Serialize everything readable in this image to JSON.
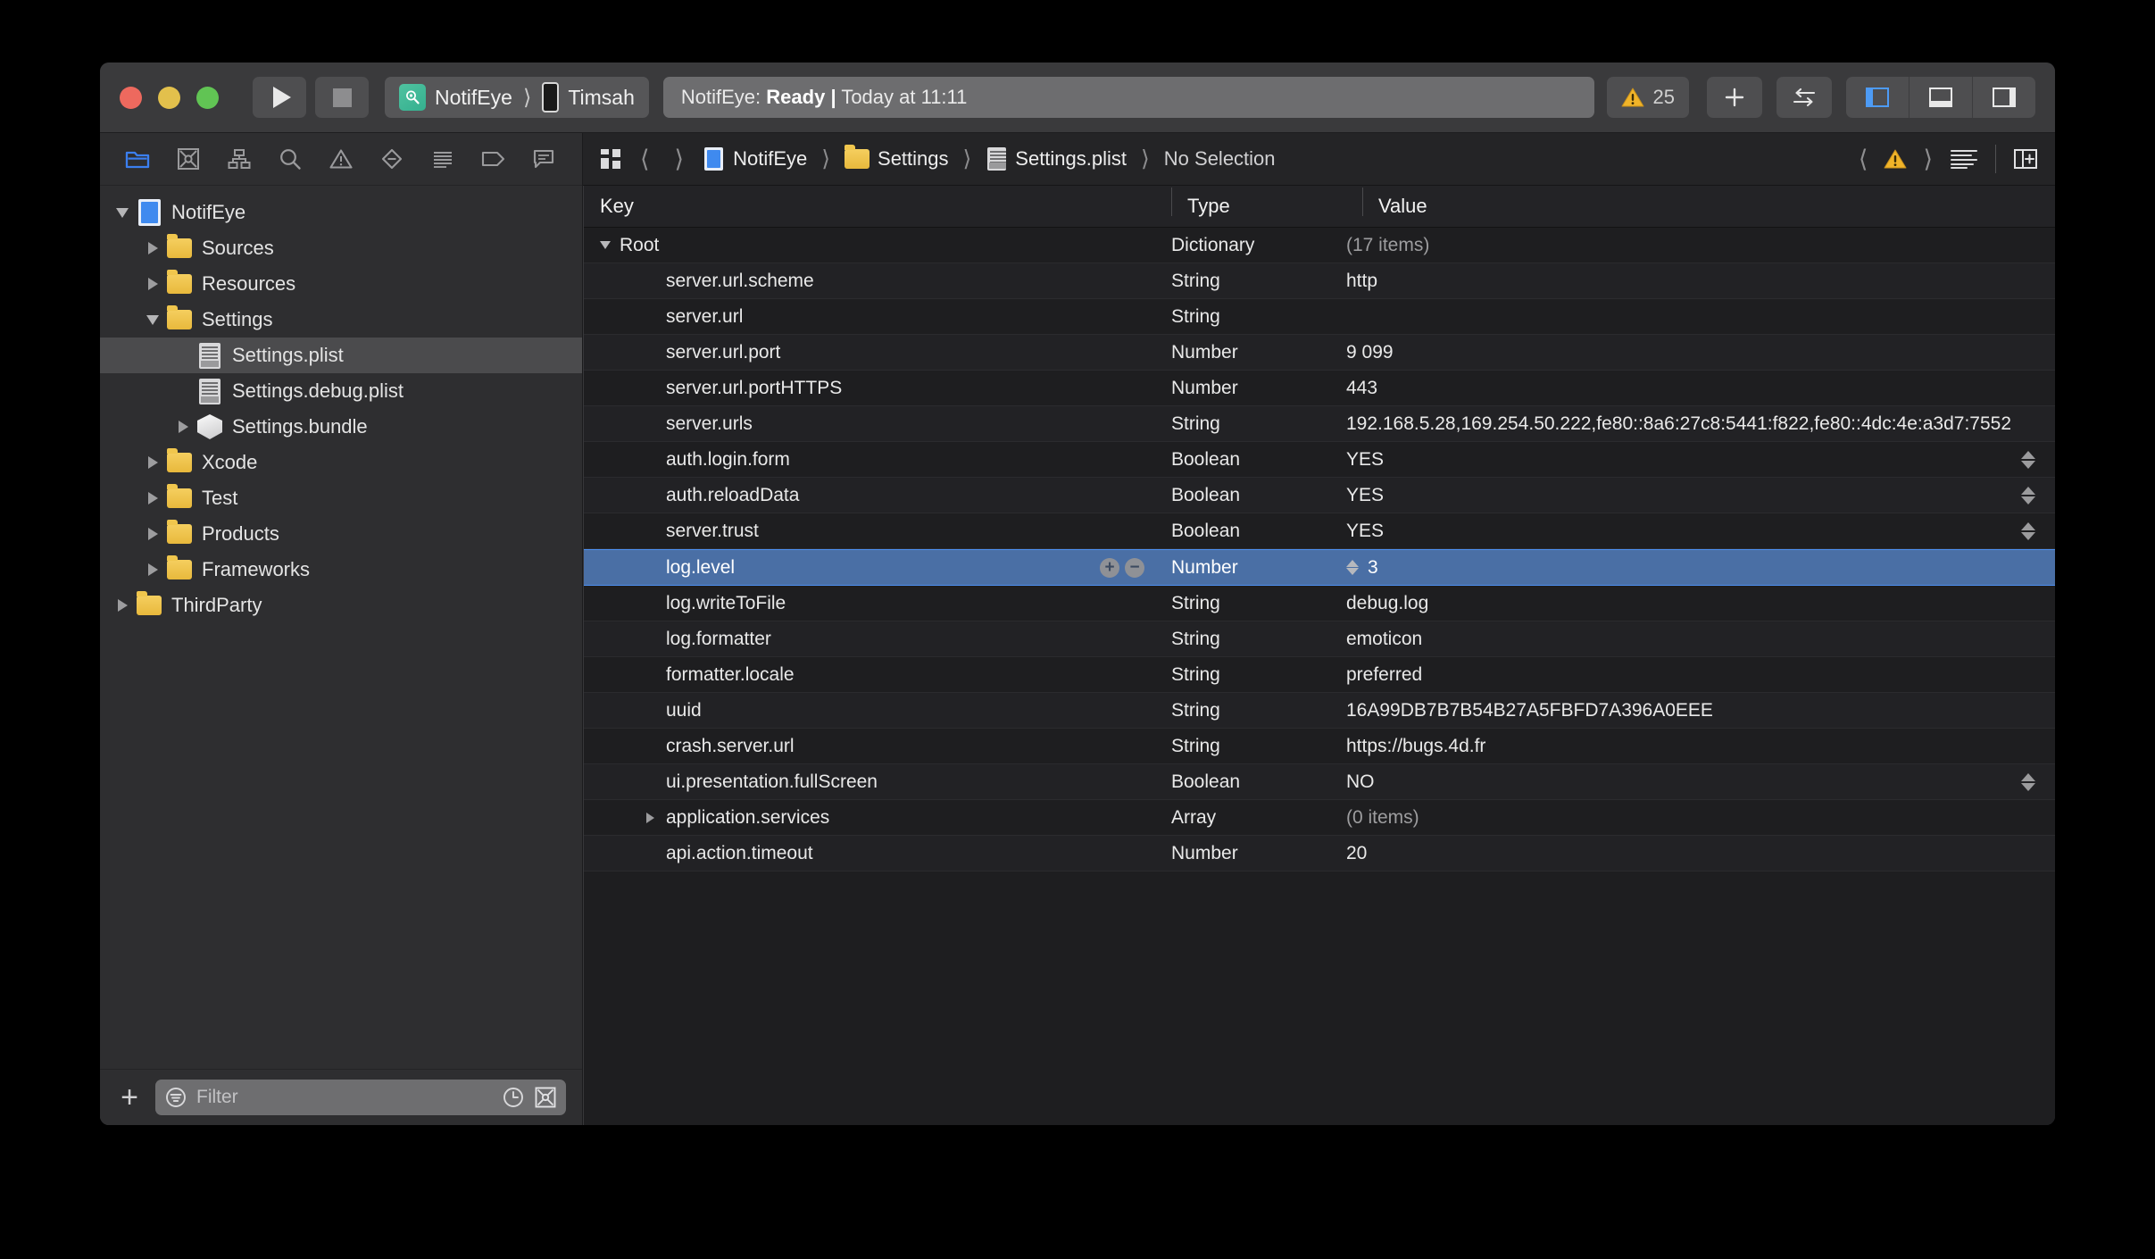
{
  "titlebar": {
    "scheme": {
      "project": "NotifEye",
      "destination": "Timsah",
      "icon": "app-scheme-icon",
      "device_icon": "iphone-icon"
    },
    "run_icon": "play-icon",
    "stop_icon": "stop-icon",
    "status": {
      "prefix": "NotifEye:",
      "state": "Ready",
      "separator": "|",
      "time": "Today at 11:11"
    },
    "warnings": {
      "icon": "warning-triangle-icon",
      "count": "25"
    },
    "buttons": {
      "add": "+",
      "add_icon": "plus-icon",
      "swap_icon": "swap-arrows-icon"
    },
    "panels": [
      {
        "name": "toggle-navigator",
        "icon": "left-panel-icon",
        "active": true
      },
      {
        "name": "toggle-debug-area",
        "icon": "bottom-panel-icon",
        "active": false
      },
      {
        "name": "toggle-inspector",
        "icon": "right-panel-icon",
        "active": false
      }
    ]
  },
  "navigator": {
    "tabs": [
      {
        "name": "project-navigator",
        "icon": "folder-icon",
        "active": true
      },
      {
        "name": "source-control-navigator",
        "icon": "source-control-icon",
        "active": false
      },
      {
        "name": "symbol-navigator",
        "icon": "hierarchy-icon",
        "active": false
      },
      {
        "name": "find-navigator",
        "icon": "search-icon",
        "active": false
      },
      {
        "name": "issue-navigator",
        "icon": "warning-triangle-icon",
        "active": false
      },
      {
        "name": "test-navigator",
        "icon": "diamond-minus-icon",
        "active": false
      },
      {
        "name": "debug-navigator",
        "icon": "lines-icon",
        "active": false
      },
      {
        "name": "breakpoint-navigator",
        "icon": "tag-icon",
        "active": false
      },
      {
        "name": "report-navigator",
        "icon": "speech-bubble-icon",
        "active": false
      }
    ],
    "tree": [
      {
        "label": "NotifEye",
        "icon": "app-icon",
        "indent": 0,
        "disclosure": "down",
        "selected": false
      },
      {
        "label": "Sources",
        "icon": "folder-icon",
        "indent": 1,
        "disclosure": "right",
        "selected": false
      },
      {
        "label": "Resources",
        "icon": "folder-icon",
        "indent": 1,
        "disclosure": "right",
        "selected": false
      },
      {
        "label": "Settings",
        "icon": "folder-icon",
        "indent": 1,
        "disclosure": "down",
        "selected": false
      },
      {
        "label": "Settings.plist",
        "icon": "plist-icon",
        "indent": 2,
        "disclosure": "none",
        "selected": true
      },
      {
        "label": "Settings.debug.plist",
        "icon": "plist-icon",
        "indent": 2,
        "disclosure": "none",
        "selected": false
      },
      {
        "label": "Settings.bundle",
        "icon": "bundle-icon",
        "indent": 2,
        "disclosure": "right",
        "selected": false
      },
      {
        "label": "Xcode",
        "icon": "folder-icon",
        "indent": 1,
        "disclosure": "right",
        "selected": false
      },
      {
        "label": "Test",
        "icon": "folder-icon",
        "indent": 1,
        "disclosure": "right",
        "selected": false
      },
      {
        "label": "Products",
        "icon": "folder-icon",
        "indent": 1,
        "disclosure": "right",
        "selected": false
      },
      {
        "label": "Frameworks",
        "icon": "folder-icon",
        "indent": 1,
        "disclosure": "right",
        "selected": false
      },
      {
        "label": "ThirdParty",
        "icon": "folder-icon",
        "indent": 0,
        "disclosure": "right",
        "selected": false
      }
    ],
    "footer": {
      "add_label": "+",
      "add_icon": "plus-icon",
      "filter_placeholder": "Filter",
      "filter_value": "",
      "filter_icon": "filter-icon",
      "recent_icon": "clock-icon",
      "scm_icon": "source-control-icon"
    }
  },
  "jumpbar": {
    "grid_icon": "related-items-icon",
    "back_icon": "chevron-left-icon",
    "forward_icon": "chevron-right-icon",
    "breadcrumbs": [
      {
        "label": "NotifEye",
        "icon": "app-icon"
      },
      {
        "label": "Settings",
        "icon": "folder-icon"
      },
      {
        "label": "Settings.plist",
        "icon": "plist-icon"
      },
      {
        "label": "No Selection",
        "icon": "none"
      }
    ],
    "right": {
      "prev_issue_icon": "chevron-left-icon",
      "issue_icon": "warning-triangle-icon",
      "next_issue_icon": "chevron-right-icon",
      "minimap_icon": "text-lines-icon",
      "add_editor_icon": "add-editor-icon"
    }
  },
  "plist": {
    "columns": [
      "Key",
      "Type",
      "Value"
    ],
    "rows": [
      {
        "key": "Root",
        "type": "Dictionary",
        "value": "(17 items)",
        "indent": 0,
        "disclosure": "down",
        "muted_value": true,
        "selected": false,
        "stepper": false,
        "editing": false
      },
      {
        "key": "server.url.scheme",
        "type": "String",
        "value": "http",
        "indent": 1,
        "disclosure": "none",
        "muted_value": false,
        "selected": false,
        "stepper": false,
        "editing": false
      },
      {
        "key": "server.url",
        "type": "String",
        "value": "",
        "indent": 1,
        "disclosure": "none",
        "muted_value": false,
        "selected": false,
        "stepper": false,
        "editing": false
      },
      {
        "key": "server.url.port",
        "type": "Number",
        "value": "9 099",
        "indent": 1,
        "disclosure": "none",
        "muted_value": false,
        "selected": false,
        "stepper": false,
        "editing": false
      },
      {
        "key": "server.url.portHTTPS",
        "type": "Number",
        "value": "443",
        "indent": 1,
        "disclosure": "none",
        "muted_value": false,
        "selected": false,
        "stepper": false,
        "editing": false
      },
      {
        "key": "server.urls",
        "type": "String",
        "value": "192.168.5.28,169.254.50.222,fe80::8a6:27c8:5441:f822,fe80::4dc:4e:a3d7:7552",
        "indent": 1,
        "disclosure": "none",
        "muted_value": false,
        "selected": false,
        "stepper": false,
        "editing": false
      },
      {
        "key": "auth.login.form",
        "type": "Boolean",
        "value": "YES",
        "indent": 1,
        "disclosure": "none",
        "muted_value": false,
        "selected": false,
        "stepper": true,
        "editing": false
      },
      {
        "key": "auth.reloadData",
        "type": "Boolean",
        "value": "YES",
        "indent": 1,
        "disclosure": "none",
        "muted_value": false,
        "selected": false,
        "stepper": true,
        "editing": false
      },
      {
        "key": "server.trust",
        "type": "Boolean",
        "value": "YES",
        "indent": 1,
        "disclosure": "none",
        "muted_value": false,
        "selected": false,
        "stepper": true,
        "editing": false
      },
      {
        "key": "log.level",
        "type": "Number",
        "value": "3",
        "indent": 1,
        "disclosure": "none",
        "muted_value": false,
        "selected": true,
        "stepper": false,
        "editing": true
      },
      {
        "key": "log.writeToFile",
        "type": "String",
        "value": "debug.log",
        "indent": 1,
        "disclosure": "none",
        "muted_value": false,
        "selected": false,
        "stepper": false,
        "editing": false
      },
      {
        "key": "log.formatter",
        "type": "String",
        "value": "emoticon",
        "indent": 1,
        "disclosure": "none",
        "muted_value": false,
        "selected": false,
        "stepper": false,
        "editing": false
      },
      {
        "key": "formatter.locale",
        "type": "String",
        "value": "preferred",
        "indent": 1,
        "disclosure": "none",
        "muted_value": false,
        "selected": false,
        "stepper": false,
        "editing": false
      },
      {
        "key": "uuid",
        "type": "String",
        "value": "16A99DB7B7B54B27A5FBFD7A396A0EEE",
        "indent": 1,
        "disclosure": "none",
        "muted_value": false,
        "selected": false,
        "stepper": false,
        "editing": false
      },
      {
        "key": "crash.server.url",
        "type": "String",
        "value": "https://bugs.4d.fr",
        "indent": 1,
        "disclosure": "none",
        "muted_value": false,
        "selected": false,
        "stepper": false,
        "editing": false
      },
      {
        "key": "ui.presentation.fullScreen",
        "type": "Boolean",
        "value": "NO",
        "indent": 1,
        "disclosure": "none",
        "muted_value": false,
        "selected": false,
        "stepper": true,
        "editing": false
      },
      {
        "key": "application.services",
        "type": "Array",
        "value": "(0 items)",
        "indent": 1,
        "disclosure": "right",
        "muted_value": true,
        "selected": false,
        "stepper": false,
        "editing": false
      },
      {
        "key": "api.action.timeout",
        "type": "Number",
        "value": "20",
        "indent": 1,
        "disclosure": "none",
        "muted_value": false,
        "selected": false,
        "stepper": false,
        "editing": false
      }
    ],
    "row_actions": {
      "add": "+",
      "remove": "−"
    }
  },
  "colors": {
    "accent_blue": "#3b7ff0",
    "selection_blue": "#4a6fa5",
    "warning_yellow": "#f0b429",
    "folder_yellow": "#efc34d",
    "scheme_teal": "#3fb897"
  }
}
